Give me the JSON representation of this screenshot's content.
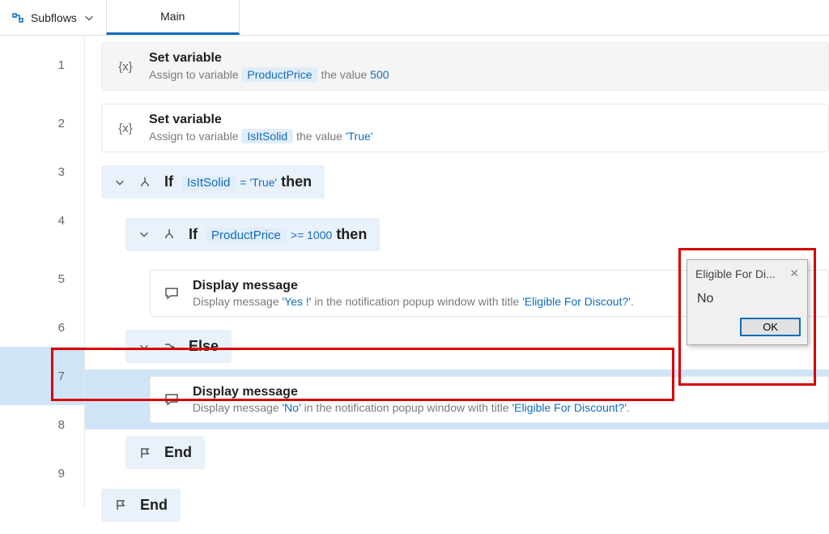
{
  "header": {
    "subflows_label": "Subflows",
    "tab_main": "Main"
  },
  "steps": {
    "s1": {
      "title": "Set variable",
      "desc_prefix": "Assign to variable",
      "var": "ProductPrice",
      "desc_mid": "the value",
      "val": "500"
    },
    "s2": {
      "title": "Set variable",
      "desc_prefix": "Assign to variable",
      "var": "IsItSolid",
      "desc_mid": "the value",
      "val": "'True'"
    },
    "s3": {
      "kw_if": "If",
      "cond_var": "IsItSolid",
      "cond_op": "= 'True'",
      "kw_then": "then"
    },
    "s4": {
      "kw_if": "If",
      "cond_var": "ProductPrice",
      "cond_op": ">= 1000",
      "kw_then": "then"
    },
    "s5": {
      "title": "Display message",
      "d1": "Display message ",
      "v1": "'Yes !'",
      "d2": " in the notification popup window with title ",
      "v2": "'Eligible For Discout?'",
      "d3": "."
    },
    "s6": {
      "kw": "Else"
    },
    "s7": {
      "title": "Display message",
      "d1": "Display message ",
      "v1": "'No'",
      "d2": " in the notification popup window with title ",
      "v2": "'Eligible For Discount?'",
      "d3": "."
    },
    "s8": {
      "kw": "End"
    },
    "s9": {
      "kw": "End"
    }
  },
  "popup": {
    "title": "Eligible For Di...",
    "body": "No",
    "ok": "OK"
  },
  "linenums": {
    "n1": "1",
    "n2": "2",
    "n3": "3",
    "n4": "4",
    "n5": "5",
    "n6": "6",
    "n7": "7",
    "n8": "8",
    "n9": "9"
  }
}
